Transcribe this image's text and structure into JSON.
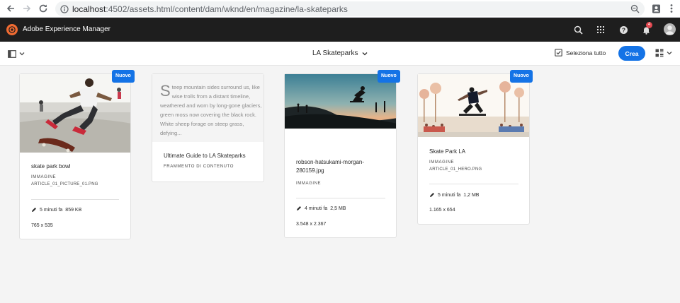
{
  "browser": {
    "url_host": "localhost",
    "url_path": ":4502/assets.html/content/dam/wknd/en/magazine/la-skateparks"
  },
  "header": {
    "app_title": "Adobe Experience Manager",
    "notification_count": "4"
  },
  "toolbar": {
    "folder_title": "LA Skateparks",
    "select_all_label": "Seleziona tutto",
    "create_label": "Crea"
  },
  "cards": [
    {
      "badge": "Nuovo",
      "title": "skate park bowl",
      "type": "IMMAGINE",
      "filename": "ARTICLE_01_PICTURE_01.PNG",
      "modified": "5 minuti fa",
      "size": "859 KB",
      "dimensions": "765 x 535"
    },
    {
      "body_initial": "S",
      "body_text": "teep mountain sides surround us, like wise trolls from a distant timeline, weathered and worn by long-gone glaciers, green moss now covering the black rock. White sheep forage on steep grass, defying...",
      "title": "Ultimate Guide to LA Skateparks",
      "type": "FRAMMENTO DI CONTENUTO"
    },
    {
      "badge": "Nuovo",
      "title": "robson-hatsukami-morgan-280159.jpg",
      "type": "IMMAGINE",
      "modified": "4 minuti fa",
      "size": "2,5 MB",
      "dimensions": "3.548 x 2.367"
    },
    {
      "badge": "Nuovo",
      "title": "Skate Park LA",
      "type": "IMMAGINE",
      "filename": "ARTICLE_01_HERO.PNG",
      "modified": "5 minuti fa",
      "size": "1,2 MB",
      "dimensions": "1.165 x 654"
    }
  ],
  "colors": {
    "accent": "#1473e6",
    "header_bg": "#1e1e1e",
    "aem_logo": "#f06b32",
    "badge_red": "#e34850"
  },
  "icons": [
    "back-arrow-icon",
    "forward-arrow-icon",
    "reload-icon",
    "info-icon",
    "zoom-icon",
    "profile-icon",
    "kebab-menu-icon",
    "search-icon",
    "apps-grid-icon",
    "help-icon",
    "bell-icon",
    "avatar",
    "rail-icon",
    "chevron-down-icon",
    "checkbox-icon",
    "card-view-icon",
    "pencil-icon"
  ]
}
